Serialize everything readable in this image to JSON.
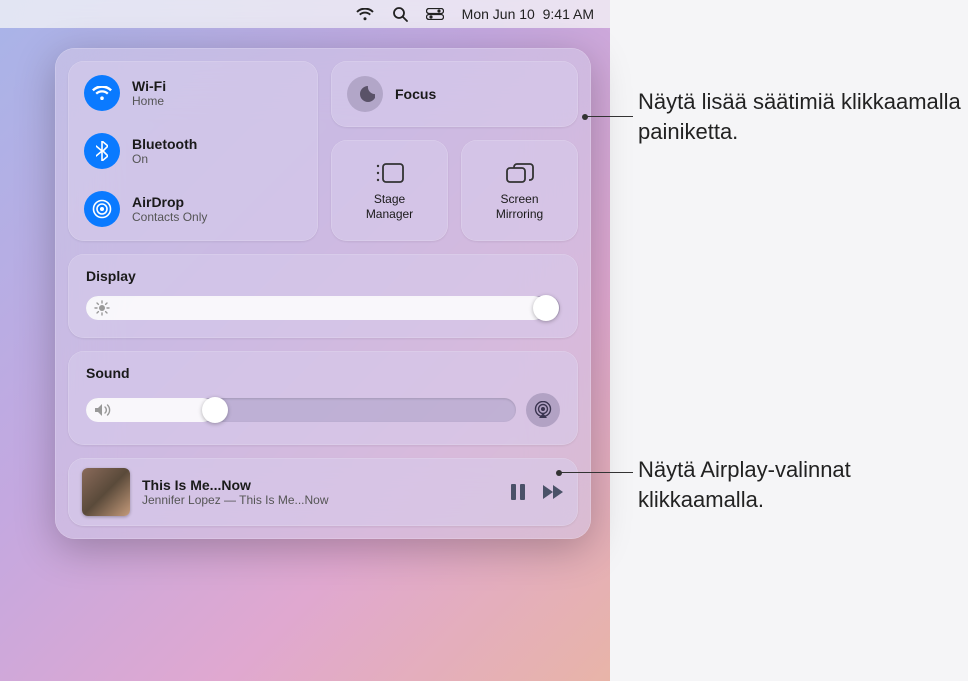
{
  "menubar": {
    "date": "Mon Jun 10",
    "time": "9:41 AM"
  },
  "conn": {
    "wifi": {
      "title": "Wi-Fi",
      "sub": "Home"
    },
    "bluetooth": {
      "title": "Bluetooth",
      "sub": "On"
    },
    "airdrop": {
      "title": "AirDrop",
      "sub": "Contacts Only"
    }
  },
  "focus": {
    "title": "Focus"
  },
  "modules": {
    "stage": "Stage\nManager",
    "mirror": "Screen\nMirroring"
  },
  "display": {
    "title": "Display",
    "value_pct": 97
  },
  "sound": {
    "title": "Sound",
    "value_pct": 30
  },
  "nowplaying": {
    "title": "This Is Me...Now",
    "sub": "Jennifer Lopez — This Is Me...Now"
  },
  "annotations": {
    "focus_hint": "Näytä lisää säätimiä klikkaamalla painiketta.",
    "airplay_hint": "Näytä Airplay-valinnat klikkaamalla."
  }
}
